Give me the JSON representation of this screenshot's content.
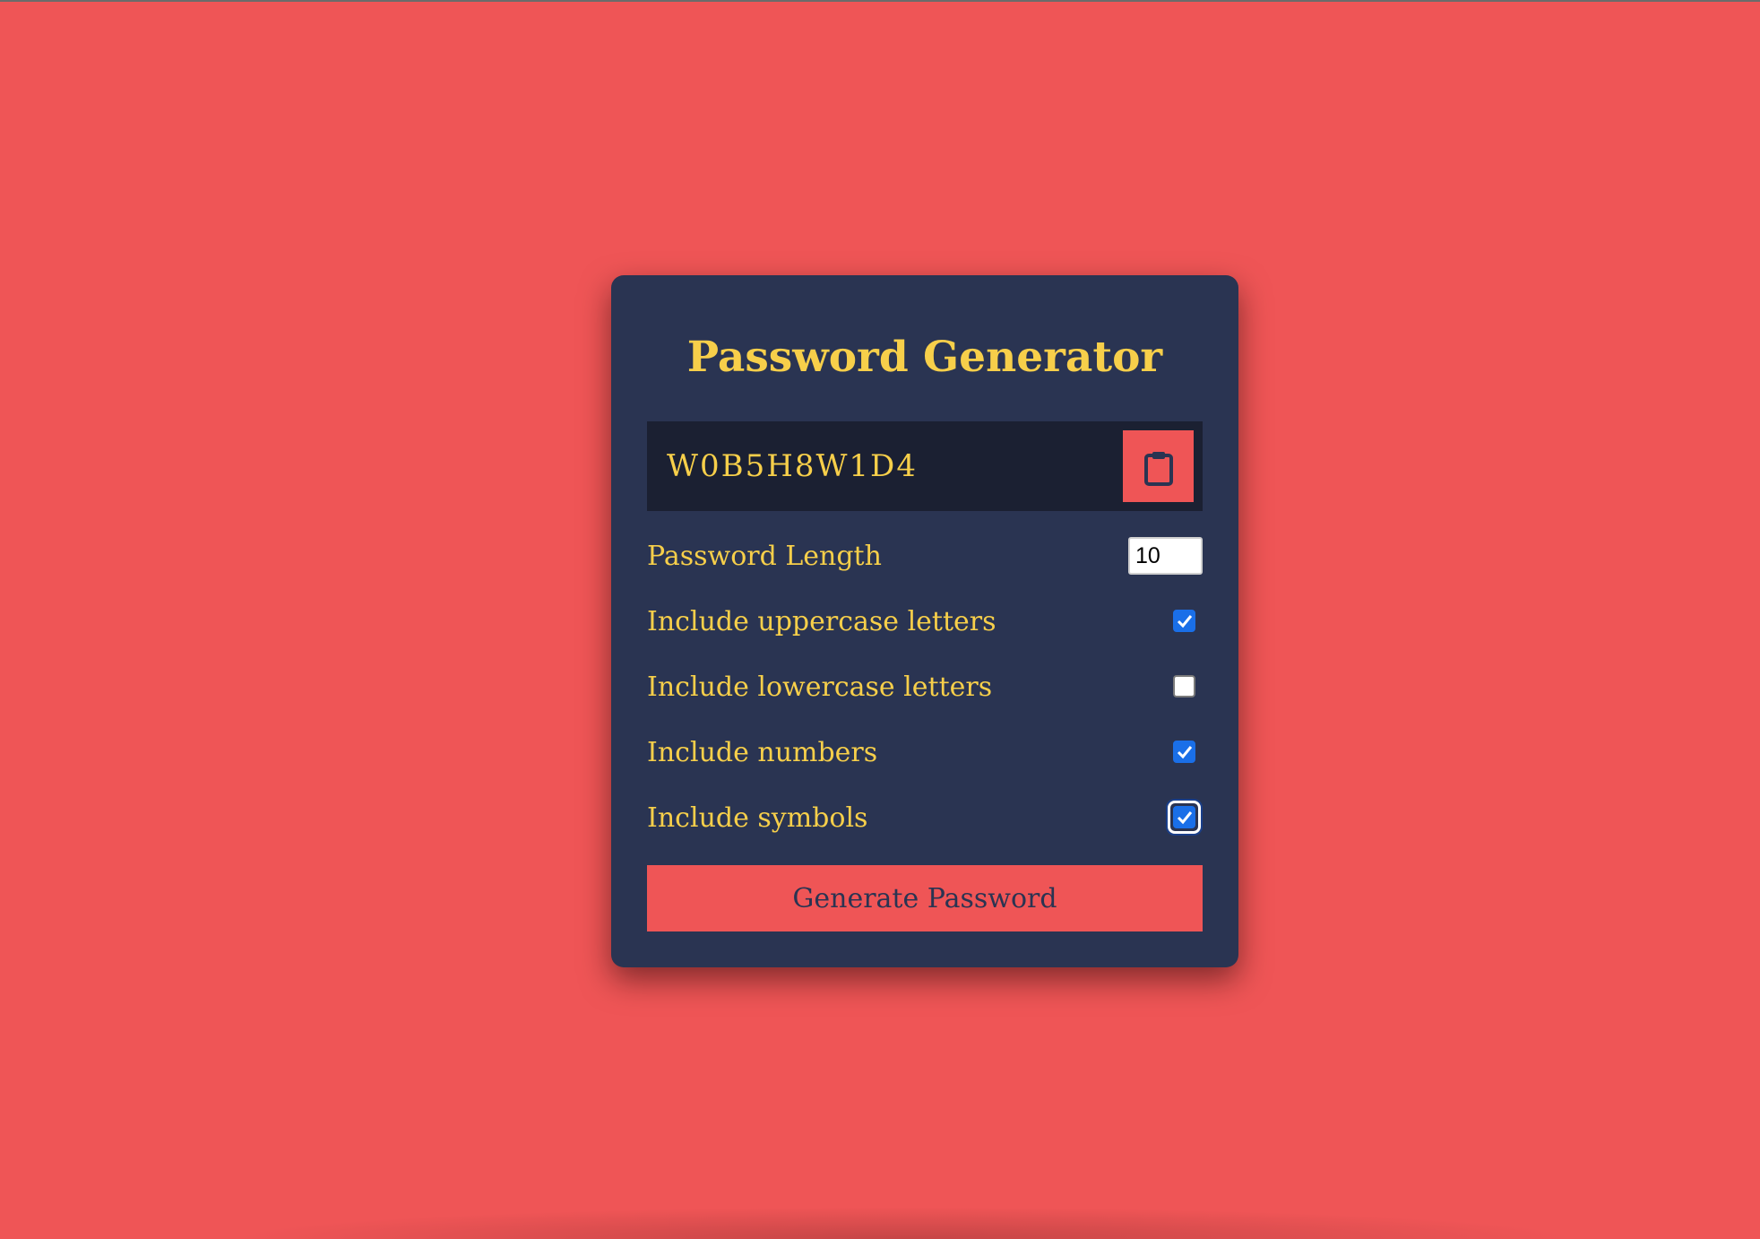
{
  "app": {
    "title": "Password Generator"
  },
  "result": {
    "password": "W0B5H8W1D4",
    "copy_icon": "clipboard-icon"
  },
  "settings": {
    "length": {
      "label": "Password Length",
      "value": "10"
    },
    "uppercase": {
      "label": "Include uppercase letters",
      "checked": true
    },
    "lowercase": {
      "label": "Include lowercase letters",
      "checked": false
    },
    "numbers": {
      "label": "Include numbers",
      "checked": true
    },
    "symbols": {
      "label": "Include symbols",
      "checked": true,
      "focused": true
    }
  },
  "actions": {
    "generate_label": "Generate Password"
  },
  "colors": {
    "background": "#ef5556",
    "card": "#2a3452",
    "result_box": "#1b2032",
    "accent_text": "#f7cf4a",
    "checkbox_checked": "#1a6fe8"
  }
}
